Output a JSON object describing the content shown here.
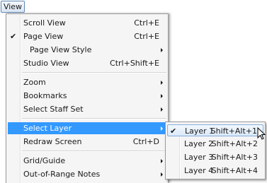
{
  "menubar": {
    "view_label": "View"
  },
  "view_menu": {
    "items": [
      {
        "label": "Scroll View",
        "shortcut": "Ctrl+E",
        "checked": false,
        "submenu": false
      },
      {
        "label": "Page View",
        "shortcut": "Ctrl+E",
        "checked": true,
        "submenu": false
      },
      {
        "label": "Page View Style",
        "shortcut": "",
        "checked": false,
        "submenu": true
      },
      {
        "label": "Studio View",
        "shortcut": "Ctrl+Shift+E",
        "checked": false,
        "submenu": false
      },
      {
        "label": "Zoom",
        "shortcut": "",
        "checked": false,
        "submenu": true
      },
      {
        "label": "Bookmarks",
        "shortcut": "",
        "checked": false,
        "submenu": true
      },
      {
        "label": "Select Staff Set",
        "shortcut": "",
        "checked": false,
        "submenu": true
      },
      {
        "label": "Select Layer",
        "shortcut": "",
        "checked": false,
        "submenu": true,
        "highlighted": true
      },
      {
        "label": "Redraw Screen",
        "shortcut": "Ctrl+D",
        "checked": false,
        "submenu": false
      },
      {
        "label": "Grid/Guide",
        "shortcut": "",
        "checked": false,
        "submenu": true
      },
      {
        "label": "Out-of-Range Notes",
        "shortcut": "",
        "checked": false,
        "submenu": true
      }
    ],
    "check_glyph": "✔"
  },
  "layer_submenu": {
    "items": [
      {
        "label": "Layer 1",
        "shortcut": "Shift+Alt+1",
        "checked": true,
        "hovered": true
      },
      {
        "label": "Layer 2",
        "shortcut": "Shift+Alt+2",
        "checked": false
      },
      {
        "label": "Layer 3",
        "shortcut": "Shift+Alt+3",
        "checked": false
      },
      {
        "label": "Layer 4",
        "shortcut": "Shift+Alt+4",
        "checked": false
      }
    ]
  },
  "colors": {
    "highlight": "#3399ff",
    "menu_bg": "#f5f5f5",
    "hover_border": "#84aedb"
  }
}
